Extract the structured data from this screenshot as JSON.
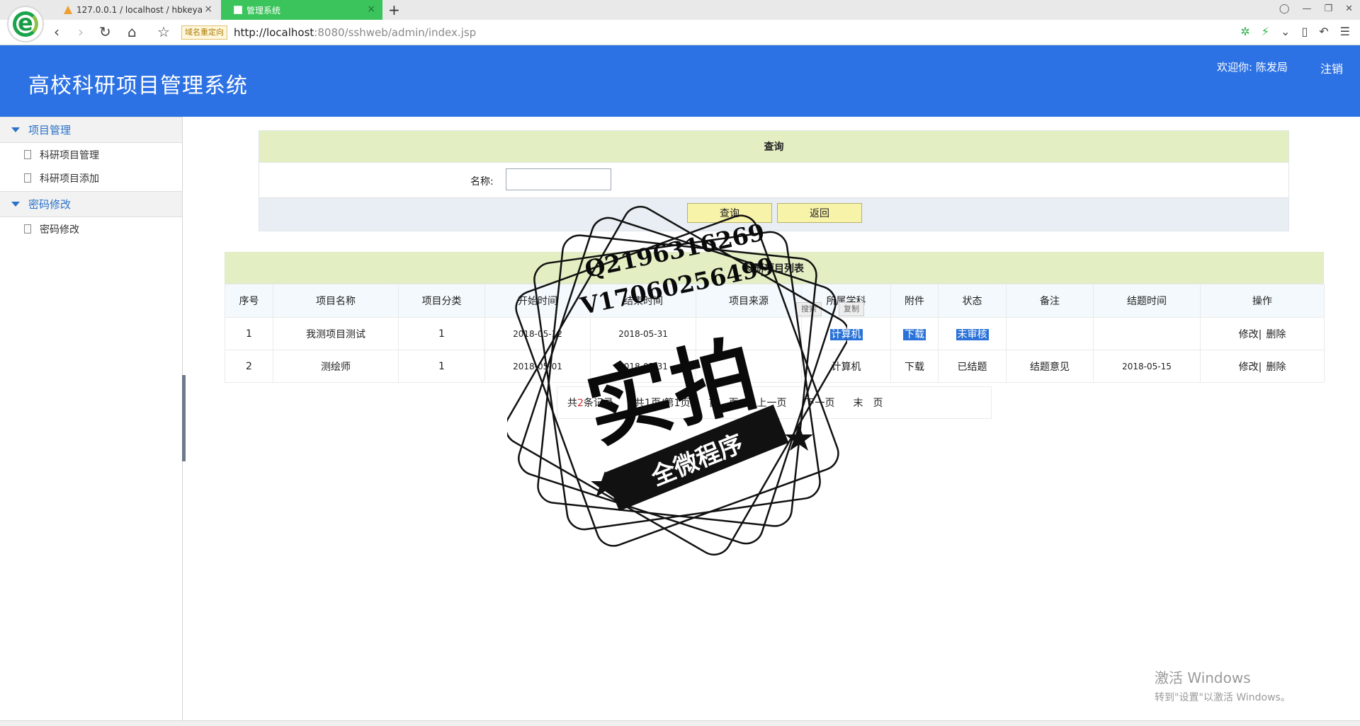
{
  "browser": {
    "tabs": [
      {
        "label": "127.0.0.1 / localhost / hbkeya"
      },
      {
        "label": "管理系统"
      }
    ],
    "redirect_badge": "域名重定向",
    "url_host": "http://localhost",
    "url_path": ":8080/sshweb/admin/index.jsp",
    "colors": {
      "active_tab": "#3cc45c",
      "header": "#2d72e4"
    }
  },
  "header": {
    "title": "高校科研项目管理系统",
    "welcome": "欢迎你: 陈发局",
    "logout": "注销"
  },
  "sidebar": {
    "groups": [
      {
        "label": "项目管理",
        "items": [
          {
            "label": "科研项目管理"
          },
          {
            "label": "科研项目添加"
          }
        ]
      },
      {
        "label": "密码修改",
        "items": [
          {
            "label": "密码修改"
          }
        ]
      }
    ]
  },
  "search": {
    "heading": "查询",
    "name_label": "名称:",
    "name_value": "",
    "query_button": "查询",
    "back_button": "返回"
  },
  "table": {
    "caption": "科研项目列表",
    "headers": [
      "序号",
      "项目名称",
      "项目分类",
      "开始时间",
      "结束时间",
      "项目来源",
      "所属学科",
      "附件",
      "状态",
      "备注",
      "结题时间",
      "操作"
    ],
    "rows": [
      {
        "no": "1",
        "name": "我测项目测试",
        "category": "1",
        "start": "2018-05-12",
        "end": "2018-05-31",
        "source": "",
        "subject": "计算机",
        "attachment": "下载",
        "status": "未审核",
        "remark": "",
        "finish": "",
        "edit": "修改|",
        "delete": "删除"
      },
      {
        "no": "2",
        "name": "测绘师",
        "category": "1",
        "start": "2018-05-01",
        "end": "2018-05-31",
        "source": "",
        "subject": "计算机",
        "attachment": "下载",
        "status": "已结题",
        "remark": "结题意见",
        "finish": "2018-05-15",
        "edit": "修改|",
        "delete": "删除"
      }
    ]
  },
  "pager": {
    "total_prefix": "共",
    "total_count": "2",
    "total_suffix": "条记录",
    "pages": "共1页/第1页",
    "first": "首　页",
    "prev": "上一页",
    "next": "下一页",
    "last": "末　页"
  },
  "overlay": {
    "search_btn": "搜索",
    "copy_btn": "复制",
    "stamp_q": "Q2196316269",
    "stamp_v": "V17060256499",
    "stamp_big": "实拍",
    "stamp_ribbon": "全微程序",
    "activate_title": "激活 Windows",
    "activate_sub": "转到\"设置\"以激活 Windows。"
  }
}
